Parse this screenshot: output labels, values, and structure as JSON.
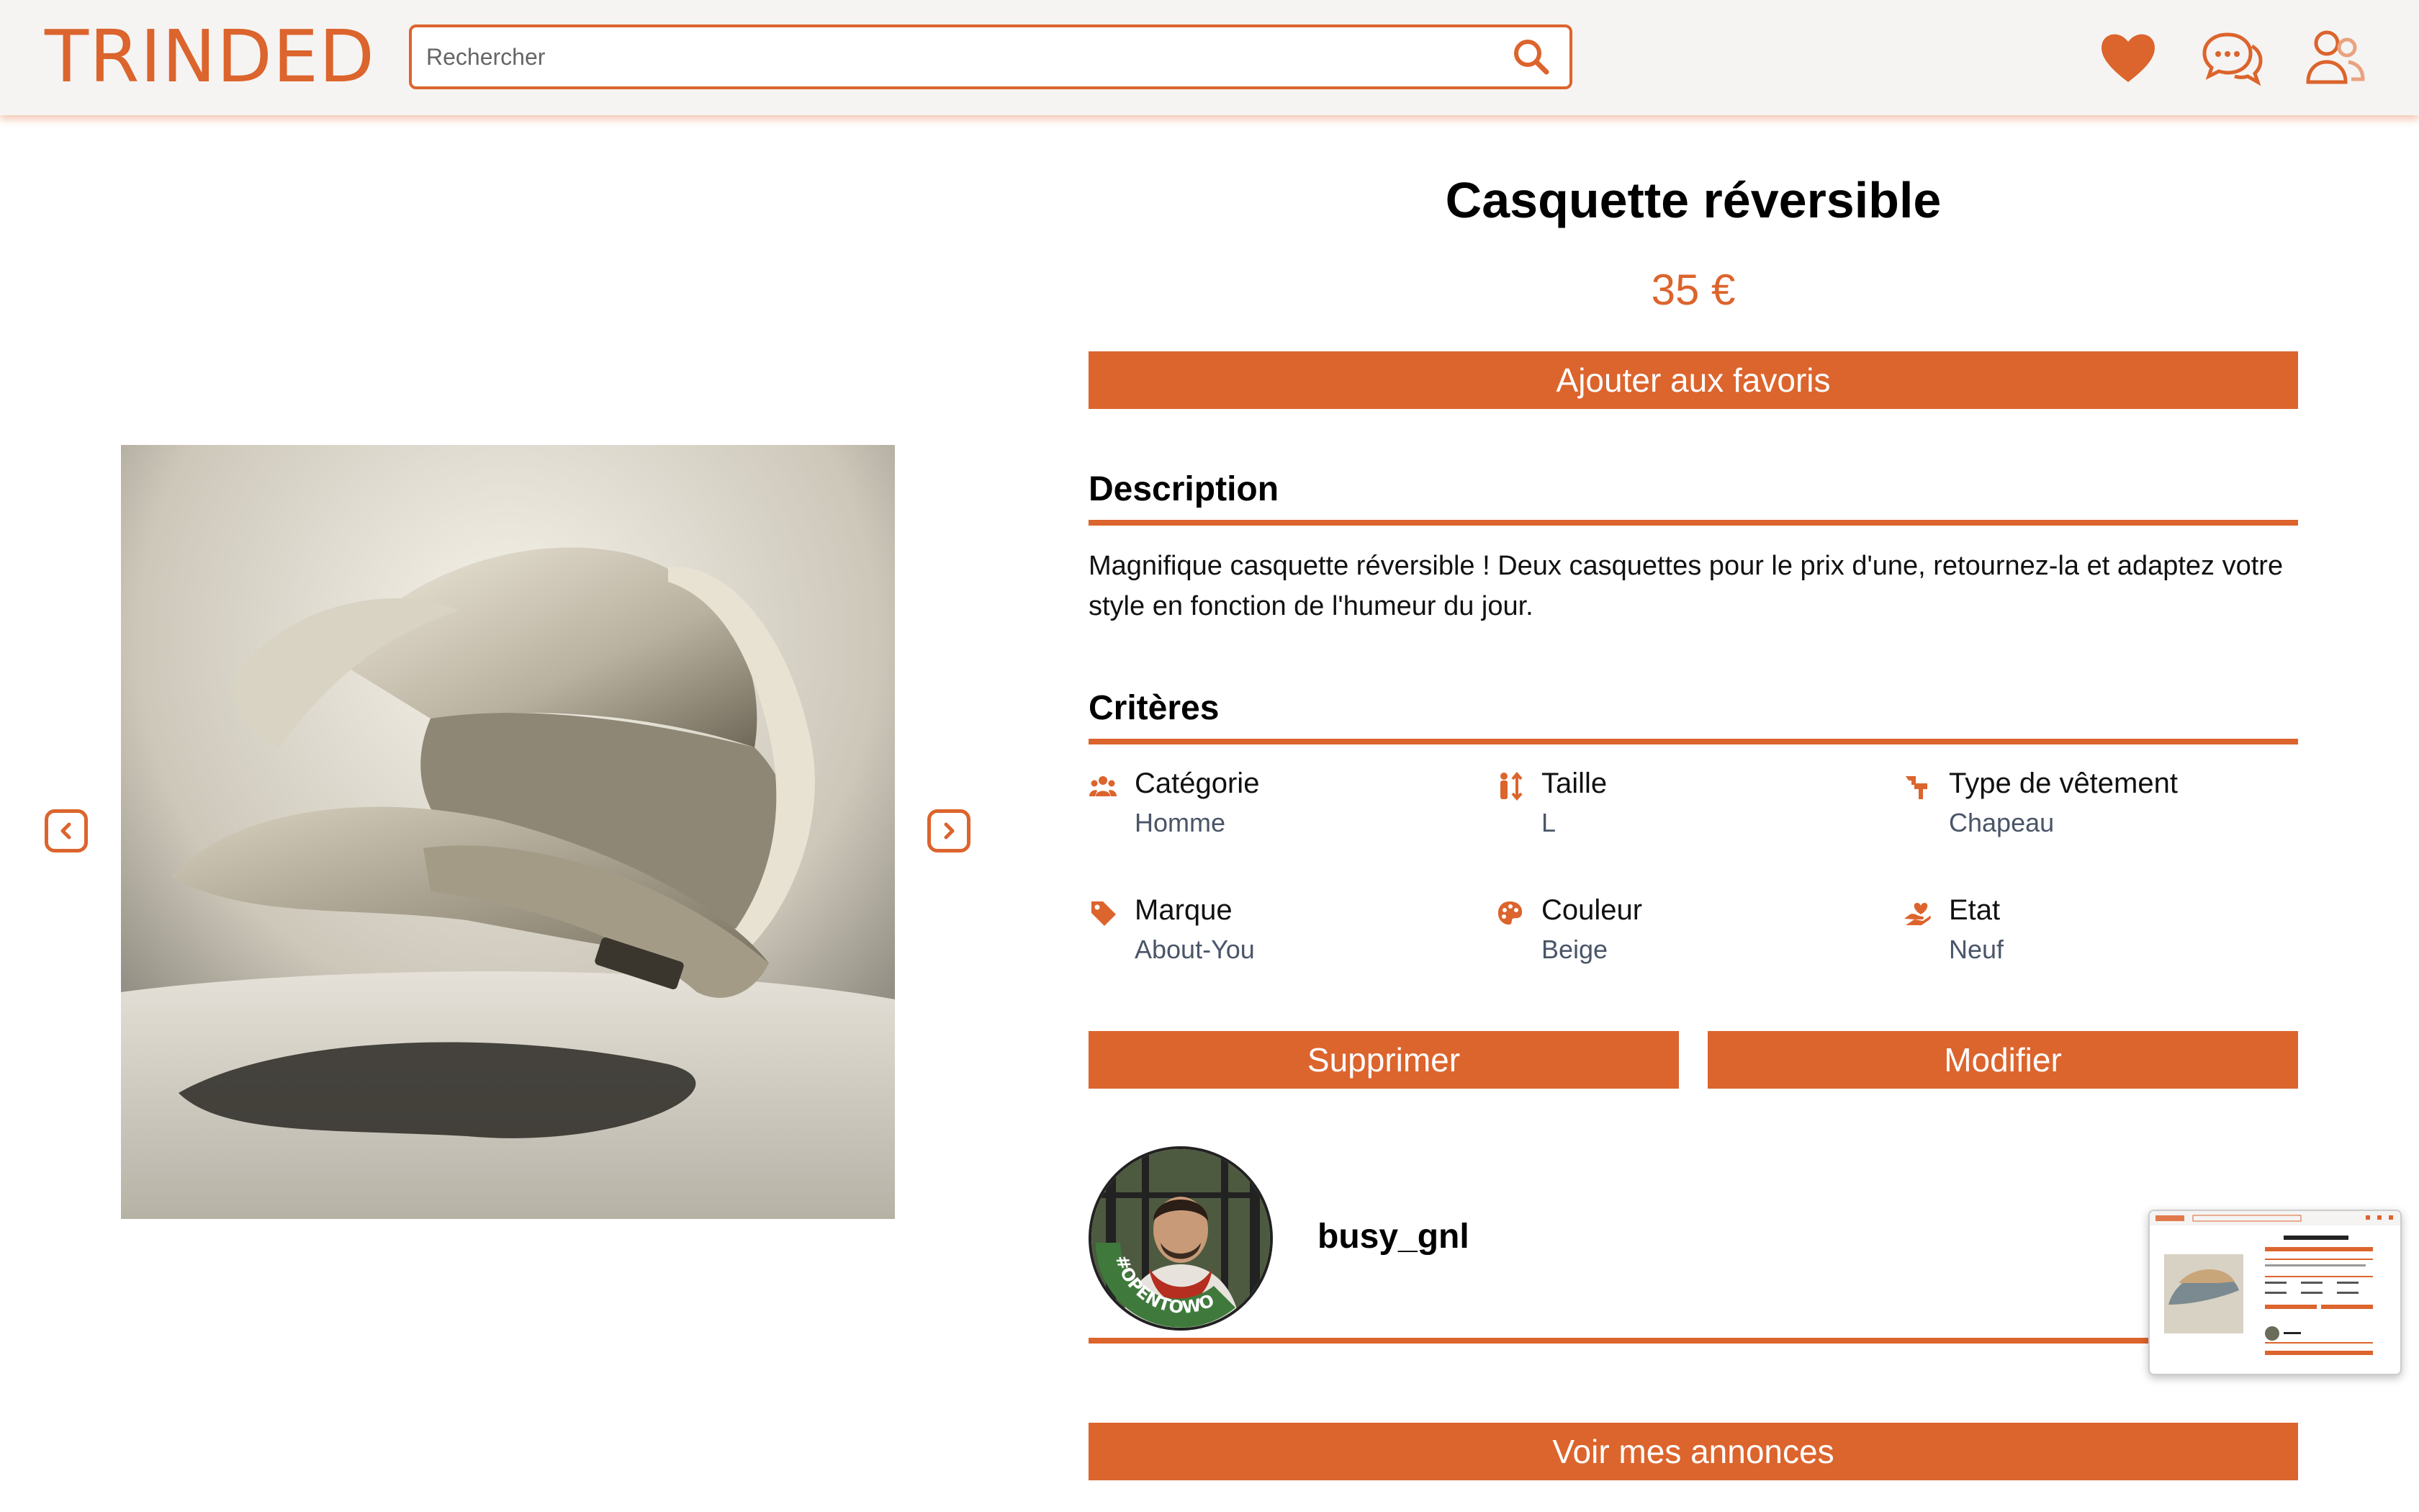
{
  "header": {
    "logo": "TRINDED",
    "search_placeholder": "Rechercher"
  },
  "icons": {
    "search": "search-icon",
    "favorites": "heart-icon",
    "messages": "chat-bubbles-icon",
    "account": "users-icon",
    "prev": "chevron-left-icon",
    "next": "chevron-right-icon"
  },
  "colors": {
    "accent": "#dc642d",
    "header_bg": "#f5f4f2",
    "value_text": "#4a5568"
  },
  "product": {
    "title": "Casquette réversible",
    "price": "35 €",
    "add_favorite_label": "Ajouter aux favoris",
    "description_title": "Description",
    "description": "Magnifique casquette réversible ! Deux casquettes pour le prix d'une, retournez-la et adaptez votre style en fonction de l'humeur du jour.",
    "criteria_title": "Critères",
    "criteria": [
      {
        "label": "Catégorie",
        "value": "Homme",
        "icon": "people-icon"
      },
      {
        "label": "Taille",
        "value": "L",
        "icon": "size-icon"
      },
      {
        "label": "Type de vêtement",
        "value": "Chapeau",
        "icon": "clothing-icon"
      },
      {
        "label": "Marque",
        "value": "About-You",
        "icon": "tag-icon"
      },
      {
        "label": "Couleur",
        "value": "Beige",
        "icon": "palette-icon"
      },
      {
        "label": "Etat",
        "value": "Neuf",
        "icon": "hand-heart-icon"
      }
    ],
    "delete_label": "Supprimer",
    "edit_label": "Modifier"
  },
  "seller": {
    "username": "busy_gnl",
    "badge_text": "#OPENTOWORK",
    "listings_label": "Voir mes annonces"
  }
}
